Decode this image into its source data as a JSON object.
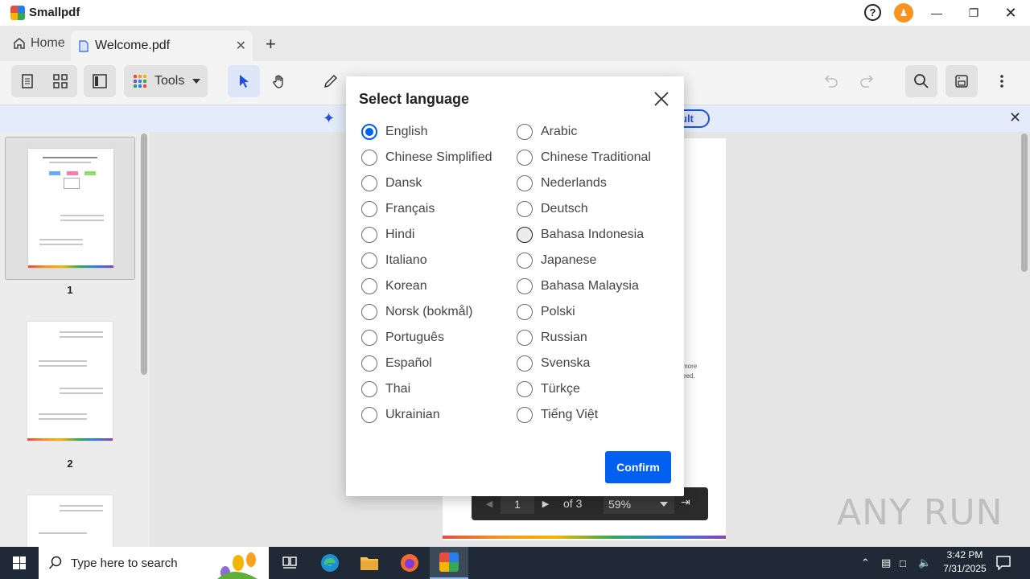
{
  "app": {
    "name": "Smallpdf"
  },
  "tabs": {
    "home_label": "Home",
    "doc_label": "Welcome.pdf"
  },
  "toolbar": {
    "tools_label": "Tools"
  },
  "banner": {
    "pill_text": "ult"
  },
  "thumbnails": [
    {
      "num": "1"
    },
    {
      "num": "2"
    }
  ],
  "doc_snippet": {
    "line1": "more",
    "line2": "eed."
  },
  "pagenav": {
    "current_page": "1",
    "of_text": "of 3",
    "zoom": "59%"
  },
  "modal": {
    "title": "Select language",
    "confirm_label": "Confirm",
    "languages_left": [
      "English",
      "Chinese Simplified",
      "Dansk",
      "Français",
      "Hindi",
      "Italiano",
      "Korean",
      "Norsk (bokmål)",
      "Português",
      "Español",
      "Thai",
      "Ukrainian"
    ],
    "languages_right": [
      "Arabic",
      "Chinese Traditional",
      "Nederlands",
      "Deutsch",
      "Bahasa Indonesia",
      "Japanese",
      "Bahasa Malaysia",
      "Polski",
      "Russian",
      "Svenska",
      "Türkçe",
      "Tiếng Việt"
    ],
    "selected": "English"
  },
  "watermark": {
    "text": "ANY RUN"
  },
  "taskbar": {
    "search_placeholder": "Type here to search",
    "time": "3:42 PM",
    "date": "7/31/2025"
  },
  "colors": {
    "accent": "#0060f0",
    "avatar": "#f7931e",
    "taskbar": "#1f2a36"
  }
}
